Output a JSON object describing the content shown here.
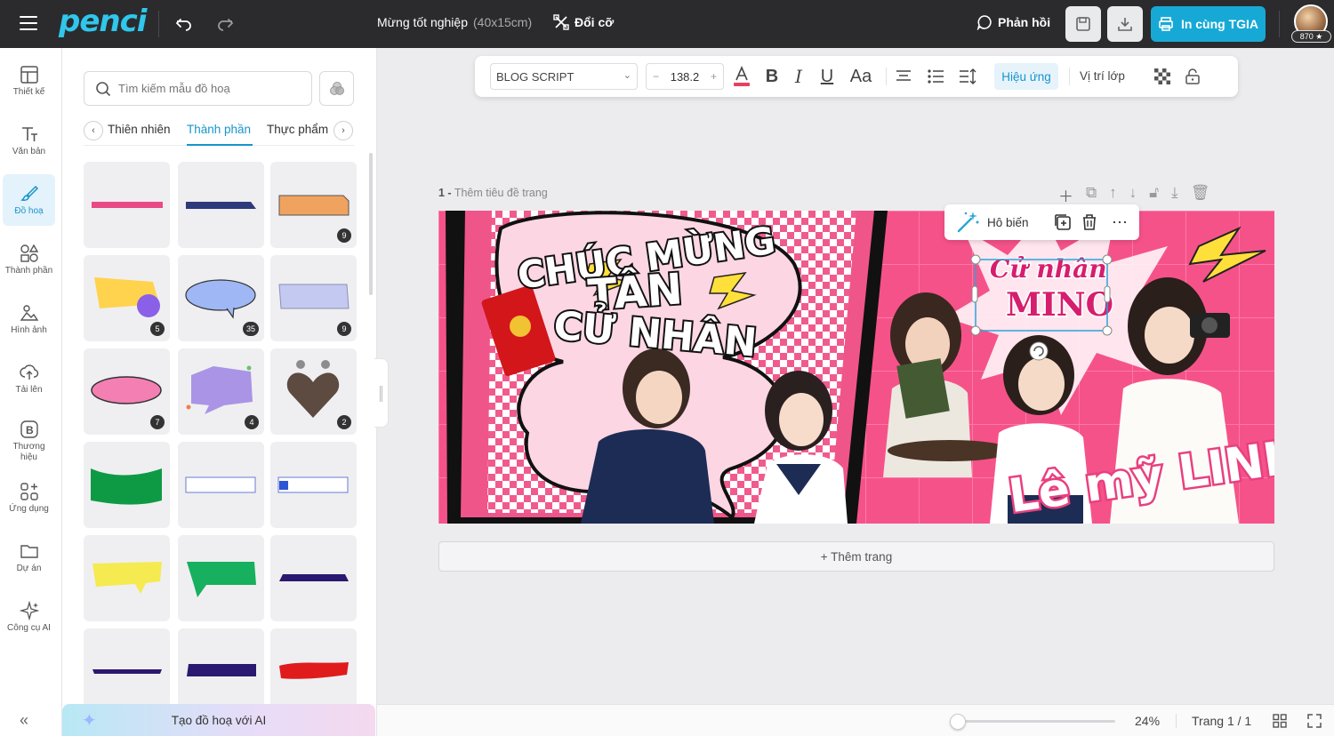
{
  "app": {
    "logo": "penci"
  },
  "header": {
    "doc_title": "Mừng tốt nghiệp",
    "doc_size": "(40x15cm)",
    "resize_label": "Đổi cỡ",
    "feedback_label": "Phản hồi",
    "print_label": "In cùng TGIA",
    "points": "870"
  },
  "rail": {
    "items": [
      {
        "label": "Thiết kế",
        "icon": "layout-icon"
      },
      {
        "label": "Văn bản",
        "icon": "text-icon"
      },
      {
        "label": "Đồ hoạ",
        "icon": "brush-icon"
      },
      {
        "label": "Thành phần",
        "icon": "elements-icon"
      },
      {
        "label": "Hình ảnh",
        "icon": "image-icon"
      },
      {
        "label": "Tải lên",
        "icon": "upload-icon"
      },
      {
        "label": "Thương hiệu",
        "icon": "brand-icon"
      },
      {
        "label": "Ứng dụng",
        "icon": "apps-icon"
      },
      {
        "label": "Dự án",
        "icon": "folder-icon"
      },
      {
        "label": "Công cụ AI",
        "icon": "sparkle-icon"
      }
    ]
  },
  "panel": {
    "search_placeholder": "Tìm kiếm mẫu đồ hoạ",
    "categories": [
      "Thiên nhiên",
      "Thành phần",
      "Thực phẩm"
    ],
    "badges": {
      "t2": "9",
      "t3": "5",
      "t4": "35",
      "t5": "9",
      "t6": "7",
      "t7": "4",
      "t8": "2"
    },
    "ai_label": "Tạo đồ hoạ với AI"
  },
  "text_toolbar": {
    "font": "BLOG SCRIPT",
    "size": "138.2",
    "case_label": "Aa",
    "effects_label": "Hiệu ứng",
    "position_label": "Vị trí lớp"
  },
  "page": {
    "number": "1 -",
    "title_placeholder": "Thêm tiêu đề trang",
    "add_page": "+ Thêm trang"
  },
  "floating_toolbar": {
    "magic_label": "Hô biến"
  },
  "canvas": {
    "headline_1": "CHÚC MỪNG",
    "headline_2": "TÂN",
    "headline_3": "CỬ NHÂN",
    "tag_line1": "Cử nhân",
    "tag_line2": "MINO",
    "name": "Lê mỹ LINH"
  },
  "status": {
    "zoom": "24%",
    "zoom_fraction": 0.05,
    "page_info": "Trang 1 / 1"
  },
  "colors": {
    "accent": "#1795cc",
    "brand": "#2fc7ec",
    "print_button": "#17a9d6",
    "canvas_pink": "#f0558a"
  }
}
